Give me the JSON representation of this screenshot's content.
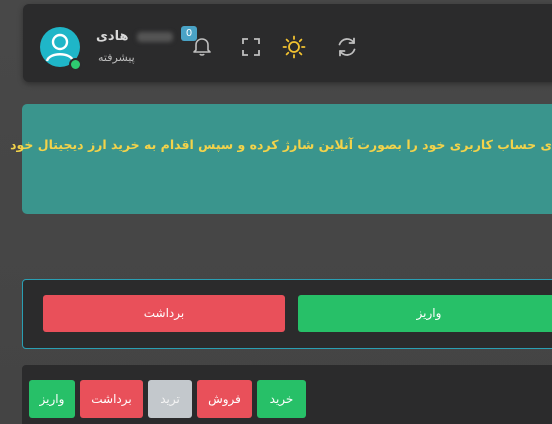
{
  "header": {
    "user_name": "هادی",
    "user_level": "پیشرفته",
    "notification_count": "0",
    "icons": {
      "bell": "bell-icon",
      "fullscreen": "fullscreen-icon",
      "theme": "sun-icon",
      "refresh": "refresh-icon",
      "avatar": "user-avatar-icon"
    },
    "colors": {
      "avatar": "#1fb6c8",
      "online": "#2ecc71",
      "theme_icon": "#f2c230",
      "badge": "#4aa3c6"
    }
  },
  "alert": {
    "message": "ی حساب کاربری خود را بصورت آنلاین شارژ کرده و سپس اقدام به خرید ارز دیجیتال خود",
    "background": "#3a958d",
    "text_color": "#f3d34a"
  },
  "actions": {
    "withdraw_label": "برداشت",
    "deposit_label": "واریز"
  },
  "toolbar": {
    "buy_label": "خرید",
    "sell_label": "فروش",
    "trade_label": "ترید",
    "withdraw_label": "برداشت",
    "deposit_label": "واریز"
  },
  "colors": {
    "success": "#27c068",
    "danger": "#e9505a",
    "neutral": "#c3c8cc",
    "panel": "#2b2b2c",
    "card_border": "#2a9fb3"
  }
}
